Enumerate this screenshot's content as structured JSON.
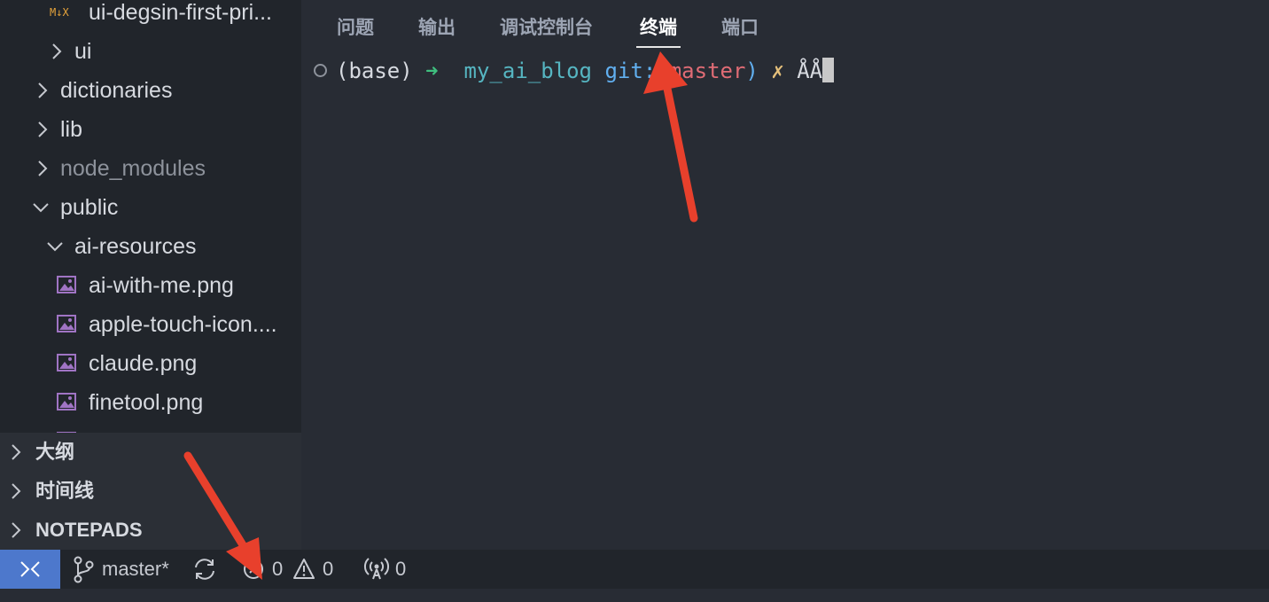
{
  "explorer": {
    "items": [
      {
        "label": "ui-degsin-first-pri...",
        "type": "file",
        "icon": "markdown-jsx-icon",
        "icon_text": "M↓X"
      },
      {
        "label": "ui",
        "type": "folder",
        "state": "collapsed"
      },
      {
        "label": "dictionaries",
        "type": "folder",
        "state": "collapsed"
      },
      {
        "label": "lib",
        "type": "folder",
        "state": "collapsed"
      },
      {
        "label": "node_modules",
        "type": "folder",
        "state": "collapsed",
        "dimmed": true
      },
      {
        "label": "public",
        "type": "folder",
        "state": "expanded"
      },
      {
        "label": "ai-resources",
        "type": "folder",
        "state": "expanded"
      },
      {
        "label": "ai-with-me.png",
        "type": "file",
        "icon": "image-file-icon"
      },
      {
        "label": "apple-touch-icon....",
        "type": "file",
        "icon": "image-file-icon"
      },
      {
        "label": "claude.png",
        "type": "file",
        "icon": "image-file-icon"
      },
      {
        "label": "finetool.png",
        "type": "file",
        "icon": "image-file-icon"
      }
    ]
  },
  "panels": [
    {
      "label": "大纲"
    },
    {
      "label": "时间线"
    },
    {
      "label": "NOTEPADS"
    }
  ],
  "panel_tabs": [
    {
      "label": "问题",
      "active": false
    },
    {
      "label": "输出",
      "active": false
    },
    {
      "label": "调试控制台",
      "active": false
    },
    {
      "label": "终端",
      "active": true
    },
    {
      "label": "端口",
      "active": false
    }
  ],
  "terminal": {
    "env": "(base)",
    "arrow": "➜",
    "dir": "my_ai_blog",
    "git_prefix": "git:(",
    "branch": "master",
    "git_suffix": ")",
    "dirty": "✗",
    "input": "ÅÅ"
  },
  "statusbar": {
    "branch": "master*",
    "errors": "0",
    "warnings": "0",
    "ports": "0"
  },
  "colors": {
    "annotation_arrow": "#e8402c",
    "remote_button": "#4d78cc",
    "image_icon": "#a074c4"
  }
}
